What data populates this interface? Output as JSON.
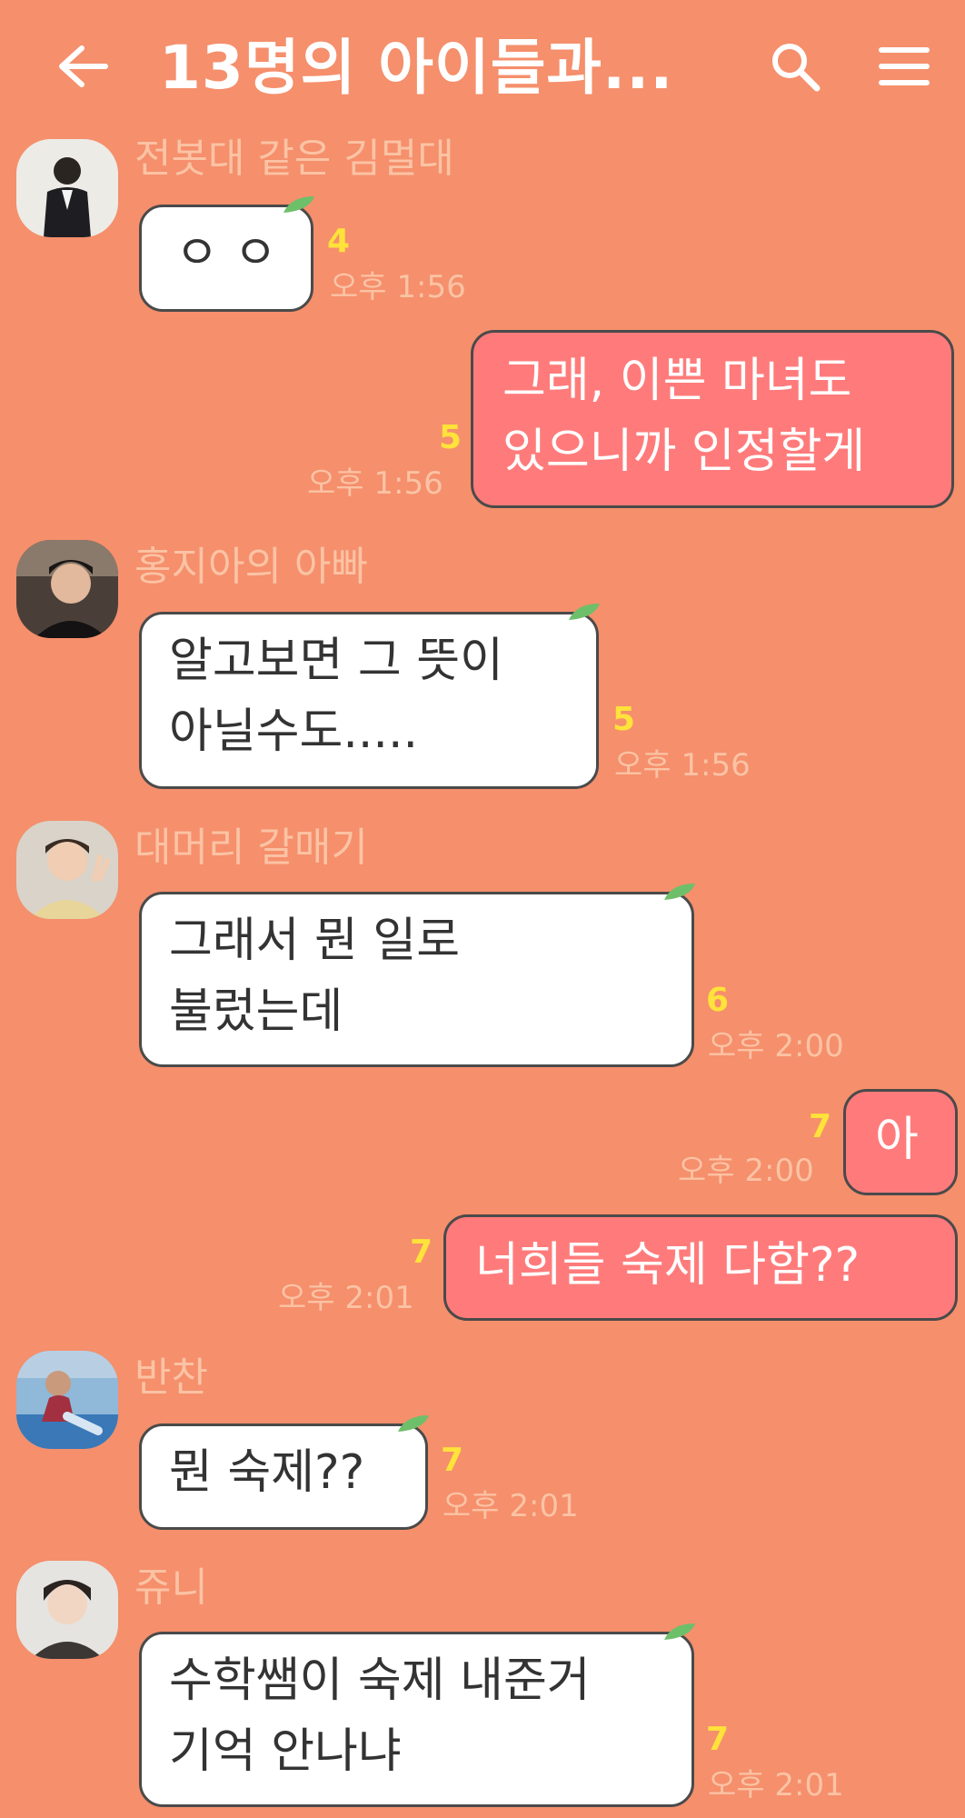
{
  "header": {
    "title": "13명의 아이들과...",
    "back_icon": "arrow-left-icon",
    "search_icon": "search-icon",
    "menu_icon": "hamburger-menu-icon"
  },
  "colors": {
    "background": "#F58F6C",
    "outgoing_bubble": "#FF7B7B",
    "incoming_bubble": "#FFFFFF",
    "unread_count": "#FFE23A",
    "meta_text": "#FBC3A4"
  },
  "messages": [
    {
      "direction": "in",
      "sender": "전봇대 같은 김멀대",
      "avatar": "avatar-photo",
      "lines": [
        "ㅇ ㅇ"
      ],
      "unread": "4",
      "time": "오후 1:56"
    },
    {
      "direction": "out",
      "lines": [
        "그래, 이쁜 마녀도",
        "있으니까 인정할게"
      ],
      "unread": "5",
      "time": "오후 1:56"
    },
    {
      "direction": "in",
      "sender": "홍지아의 아빠",
      "avatar": "avatar-photo",
      "lines": [
        "알고보면 그 뜻이",
        "아닐수도....."
      ],
      "unread": "5",
      "time": "오후 1:56"
    },
    {
      "direction": "in",
      "sender": "대머리 갈매기",
      "avatar": "avatar-photo",
      "lines": [
        "그래서 뭔 일로",
        "불렀는데"
      ],
      "unread": "6",
      "time": "오후 2:00"
    },
    {
      "direction": "out",
      "lines": [
        "아"
      ],
      "unread": "7",
      "time": "오후 2:00"
    },
    {
      "direction": "out",
      "lines": [
        "너희들 숙제 다함??"
      ],
      "unread": "7",
      "time": "오후 2:01"
    },
    {
      "direction": "in",
      "sender": "반찬",
      "avatar": "avatar-photo",
      "lines": [
        "뭔 숙제??"
      ],
      "unread": "7",
      "time": "오후 2:01"
    },
    {
      "direction": "in",
      "sender": "쥬니",
      "avatar": "avatar-photo",
      "lines": [
        "수학쌤이 숙제 내준거",
        "기억 안나냐"
      ],
      "unread": "7",
      "time": "오후 2:01"
    }
  ]
}
